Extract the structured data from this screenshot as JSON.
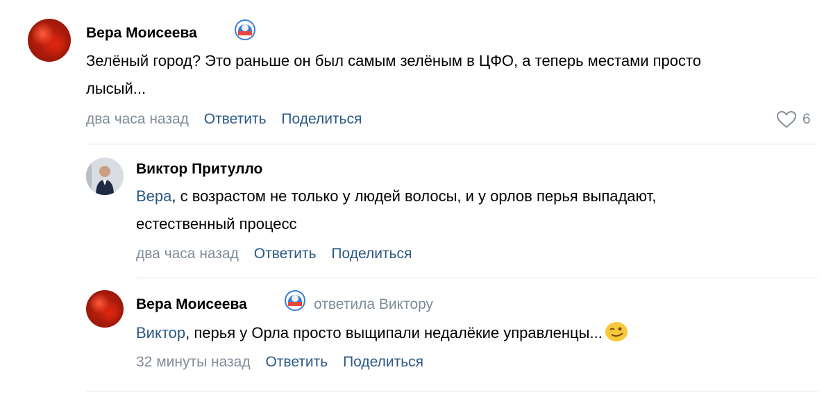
{
  "comments": [
    {
      "author": "Вера Моисеева",
      "text": "Зелёный город? Это раньше он был самым зелёным в ЦФО, а теперь местами просто лысый...",
      "time": "два часа назад",
      "reply_label": "Ответить",
      "share_label": "Поделиться",
      "likes": "6"
    },
    {
      "author": "Виктор Притулло",
      "mention": "Вера",
      "text": ", с возрастом не только у людей волосы, и у орлов перья выпадают, естественный процесс",
      "time": "два часа назад",
      "reply_label": "Ответить",
      "share_label": "Поделиться"
    },
    {
      "author": "Вера Моисеева",
      "reply_to": "ответила Виктору",
      "mention": "Виктор",
      "text": ", перья у Орла просто выщипали недалёкие управленцы...",
      "time": "32 минуты назад",
      "reply_label": "Ответить",
      "share_label": "Поделиться"
    }
  ],
  "icons": {
    "badge": "donut-badge-icon",
    "like": "heart-icon",
    "emoji": "wink-emoji-icon"
  },
  "colors": {
    "link": "#2a5885",
    "meta": "#818c99",
    "divider": "#dce1e6"
  }
}
